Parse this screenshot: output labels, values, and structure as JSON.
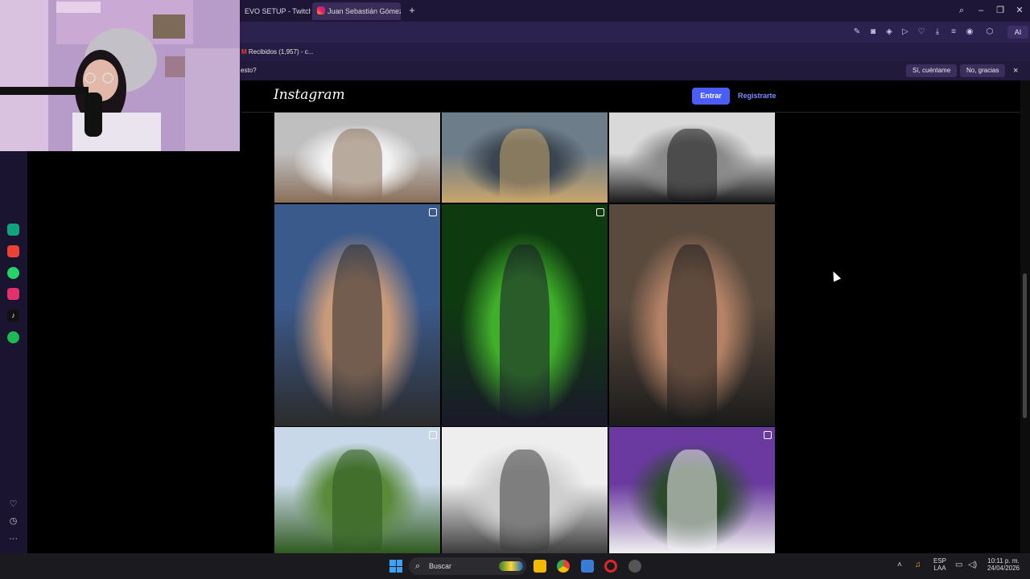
{
  "browser": {
    "tabs": [
      {
        "label": "EVO SETUP - Twitch"
      },
      {
        "label": "Juan Sebastián Gómez (@"
      }
    ],
    "new_tab": "+",
    "toolbar_ai": "AI",
    "bookmarks": [
      {
        "label": "Recibidos (1,957) - c..."
      }
    ],
    "notification": {
      "text": "esto?",
      "accept": "Sí, cuéntame",
      "decline": "No, gracias",
      "close": "×"
    }
  },
  "instagram": {
    "logo": "Instagram",
    "login_label": "Entrar",
    "signup_label": "Registrarte"
  },
  "posts": [
    {
      "row": 0,
      "col": 0,
      "multi": false,
      "description": "arm-watch",
      "palette": [
        "#bfbfbf",
        "#f2f2f2",
        "#8a6f5a"
      ]
    },
    {
      "row": 0,
      "col": 1,
      "multi": false,
      "description": "drink-lake",
      "palette": [
        "#6e7d8a",
        "#3a4550",
        "#c9a56b"
      ]
    },
    {
      "row": 0,
      "col": 2,
      "multi": false,
      "description": "stairs",
      "palette": [
        "#d9d9d9",
        "#8a8a8a",
        "#1a1a1a"
      ]
    },
    {
      "row": 1,
      "col": 0,
      "multi": true,
      "description": "shirtless-gym-sunglasses",
      "palette": [
        "#3b5a8c",
        "#c79a7a",
        "#2b2b2b"
      ]
    },
    {
      "row": 1,
      "col": 1,
      "multi": true,
      "description": "suit-garden",
      "palette": [
        "#0e3a10",
        "#3fae2a",
        "#1a1a2a"
      ]
    },
    {
      "row": 1,
      "col": 2,
      "multi": false,
      "description": "shirtless-gym-dumbbells",
      "palette": [
        "#5a4a3e",
        "#b48266",
        "#1b1b1b"
      ]
    },
    {
      "row": 2,
      "col": 0,
      "multi": true,
      "description": "countryside",
      "palette": [
        "#c8d8e8",
        "#5a8a3a",
        "#2f5a1f"
      ]
    },
    {
      "row": 2,
      "col": 1,
      "multi": false,
      "description": "sneaker-closet",
      "palette": [
        "#eeeeee",
        "#cfcfcf",
        "#3d3d3d"
      ]
    },
    {
      "row": 2,
      "col": 2,
      "multi": true,
      "description": "group-photo",
      "palette": [
        "#6a3aa0",
        "#2d4a2d",
        "#f0f0f0"
      ]
    }
  ],
  "sidebar_apps": [
    {
      "icon": "chatgpt-icon",
      "color": "#10a37f"
    },
    {
      "icon": "gmail-icon",
      "color": "#ea4335"
    },
    {
      "icon": "whatsapp-icon",
      "color": "#25d366"
    },
    {
      "icon": "instagram-icon",
      "color": "#e1306c"
    },
    {
      "icon": "tiktok-icon",
      "color": "#111111"
    },
    {
      "icon": "spotify-icon",
      "color": "#1db954"
    }
  ],
  "taskbar": {
    "search_label": "Buscar",
    "lang_top": "ESP",
    "lang_bottom": "LAA",
    "time": "10:11 p. m.",
    "date": "24/04/2026"
  }
}
